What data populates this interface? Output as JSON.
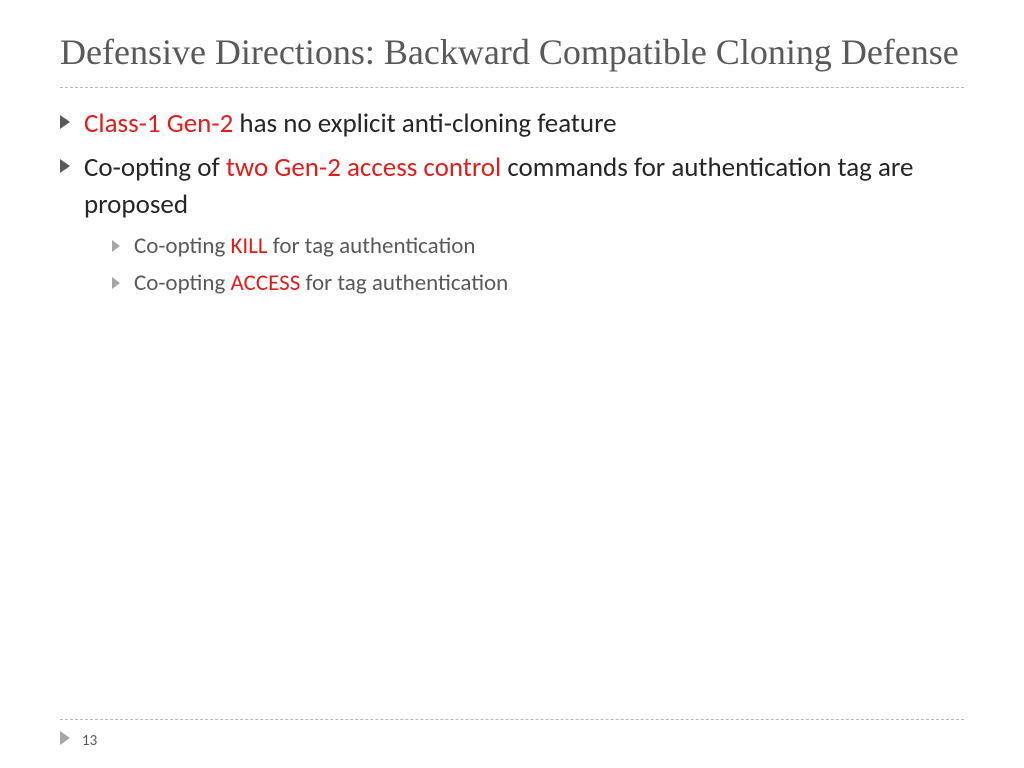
{
  "title": "Defensive Directions: Backward Compatible Cloning Defense",
  "colors": {
    "emph": "#e31b1b",
    "muted": "#595959",
    "gray_arrow": "#a6a6a6"
  },
  "bullets": {
    "b0": {
      "em": "Class-1 Gen-2",
      "rest": " has no explicit anti-cloning feature"
    },
    "b1": {
      "pre": "Co-opting of ",
      "em": "two Gen-2 access control",
      "post": " commands for authentication tag are proposed"
    },
    "b1a": {
      "pre": "Co-opting ",
      "em": "KILL",
      "post": " for tag authentication"
    },
    "b1b": {
      "pre": "Co-opting ",
      "em": "ACCESS",
      "post": " for tag authentication"
    }
  },
  "page_number": "13"
}
